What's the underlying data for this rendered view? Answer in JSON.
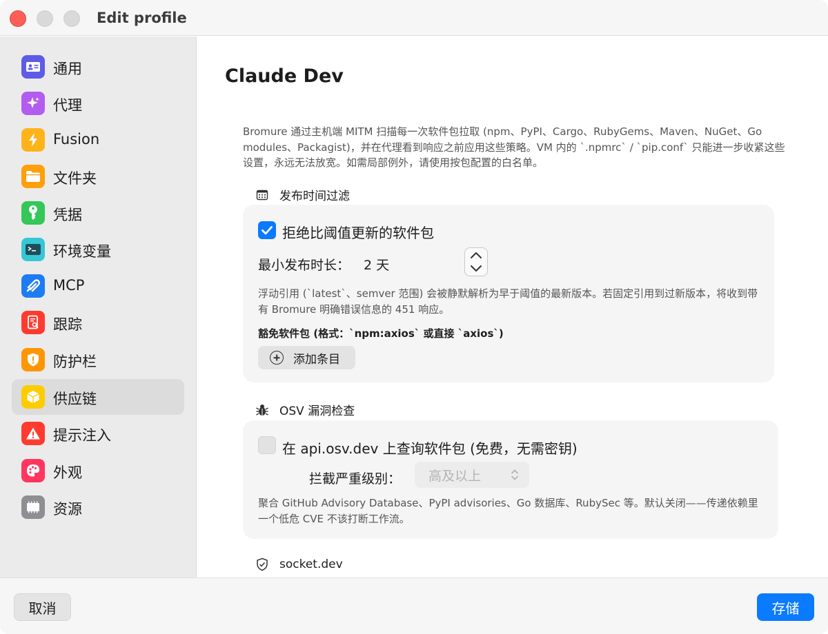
{
  "window": {
    "title": "Edit profile"
  },
  "sidebar": {
    "items": [
      {
        "label": "通用",
        "icon": "id-card-icon",
        "color": "#5e5ce6"
      },
      {
        "label": "代理",
        "icon": "sparkles-icon",
        "color": "#b35cf0"
      },
      {
        "label": "Fusion",
        "icon": "bolt-icon",
        "color": "#ffb31a"
      },
      {
        "label": "文件夹",
        "icon": "folder-icon",
        "color": "#ff9f0a"
      },
      {
        "label": "凭据",
        "icon": "key-icon",
        "color": "#34c759"
      },
      {
        "label": "环境变量",
        "icon": "terminal-icon",
        "color": "#35c7d6"
      },
      {
        "label": "MCP",
        "icon": "plug-icon",
        "color": "#1e7cf2"
      },
      {
        "label": "跟踪",
        "icon": "document-search-icon",
        "color": "#ff3b30"
      },
      {
        "label": "防护栏",
        "icon": "shield-alert-icon",
        "color": "#ff9500"
      },
      {
        "label": "供应链",
        "icon": "package-icon",
        "color": "#ffcc00",
        "selected": true
      },
      {
        "label": "提示注入",
        "icon": "warning-icon",
        "color": "#ff3b30"
      },
      {
        "label": "外观",
        "icon": "palette-icon",
        "color": "#ff375f"
      },
      {
        "label": "资源",
        "icon": "chip-icon",
        "color": "#8e8e93"
      }
    ]
  },
  "main": {
    "title": "Claude Dev",
    "intro": "Bromure 通过主机端 MITM 扫描每一次软件包拉取 (npm、PyPI、Cargo、RubyGems、Maven、NuGet、Go modules、Packagist)，并在代理看到响应之前应用这些策略。VM 内的 `.npmrc` / `pip.conf` 只能进一步收紧这些设置，永远无法放宽。如需局部例外，请使用按包配置的白名单。",
    "release_filter": {
      "header": "发布时间过滤",
      "checkbox_label": "拒绝比阈值更新的软件包",
      "checked": true,
      "min_age_label": "最小发布时长：",
      "min_age_value": "2 天",
      "note": "浮动引用 (`latest`、semver 范围) 会被静默解析为早于阈值的最新版本。若固定引用到过新版本，将收到带有 Bromure 明确错误信息的 451 响应。",
      "exempt_label": "豁免软件包 (格式：`npm:axios` 或直接 `axios`)",
      "add_button": "添加条目"
    },
    "osv": {
      "header": "OSV 漏洞检查",
      "checkbox_label": "在 api.osv.dev 上查询软件包 (免费，无需密钥)",
      "checked": false,
      "severity_label": "拦截严重级别：",
      "severity_value": "高及以上",
      "note": "聚合 GitHub Advisory Database、PyPI advisories、Go 数据库、RubySec 等。默认关闭——传递依赖里一个低危 CVE 不该打断工作流。"
    },
    "socket": {
      "header": "socket.dev"
    }
  },
  "footer": {
    "cancel_label": "取消",
    "save_label": "存储",
    "accent_color": "#0a7aff"
  }
}
